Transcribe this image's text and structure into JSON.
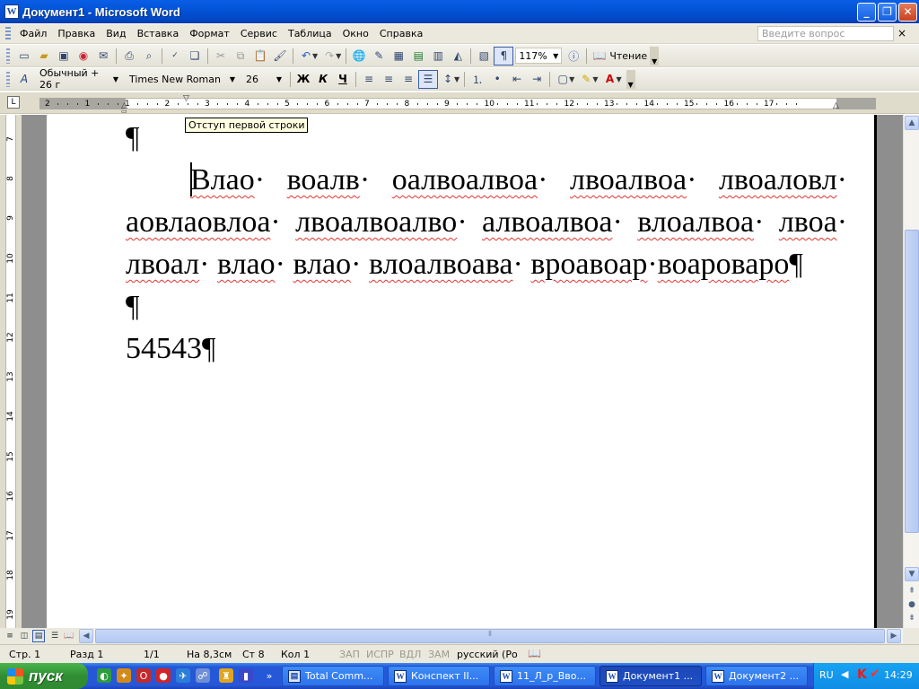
{
  "window": {
    "title": "Документ1 - Microsoft Word",
    "app_icon_letter": "W",
    "minimize": "_",
    "maximize": "❐",
    "close": "✕"
  },
  "menu": {
    "items": [
      "Файл",
      "Правка",
      "Вид",
      "Вставка",
      "Формат",
      "Сервис",
      "Таблица",
      "Окно",
      "Справка"
    ],
    "ask_placeholder": "Введите вопрос",
    "close_label": "×"
  },
  "toolbar_standard": {
    "zoom": "117%",
    "reading_label": "Чтение",
    "pilcrow": "¶"
  },
  "toolbar_formatting": {
    "style_value": "Обычный + 26 г",
    "font_value": "Times New Roman",
    "size_value": "26",
    "bold": "Ж",
    "italic": "К",
    "underline": "Ч"
  },
  "ruler": {
    "numbers": [
      "2",
      "1",
      "1",
      "2",
      "3",
      "4",
      "5",
      "6",
      "7",
      "8",
      "9",
      "10",
      "11",
      "12",
      "13",
      "14",
      "15",
      "16",
      "17"
    ],
    "tab_stop": "L",
    "tooltip": "Отступ первой строки"
  },
  "vertical_ruler": {
    "numbers": [
      "7",
      "8",
      "9",
      "10",
      "11",
      "12",
      "13",
      "14",
      "15",
      "16",
      "17",
      "18",
      "19"
    ]
  },
  "document": {
    "pilcrow": "¶",
    "main_words": [
      "Влао",
      "воалв",
      "оалвоалвоа",
      "лвоалвоа",
      "лвоаловл",
      "аовлаовлоа",
      "лвоалвоалво",
      "алвоалвоа",
      "влоалвоа",
      "лвоа",
      "лвоал",
      "влао",
      "влао",
      "влоалвоава",
      "вроавоар",
      "воароваро"
    ],
    "number_line": "54543"
  },
  "statusbar": {
    "page": "Стр. 1",
    "section": "Разд 1",
    "pages": "1/1",
    "at": "На 8,3см",
    "line": "Ст 8",
    "column": "Кол 1",
    "rec": "ЗАП",
    "trk": "ИСПР",
    "ext": "ВДЛ",
    "ovr": "ЗАМ",
    "language": "русский (Ро"
  },
  "taskbar": {
    "start_label": "пуск",
    "tasks": [
      "Total Comm...",
      "Конспект II...",
      "11_Л_р_Вво...",
      "Документ1 ...",
      "Документ2 ..."
    ],
    "active_task_index": 3,
    "language": "RU",
    "clock": "14:29"
  },
  "colors": {
    "titlebar": "#0354d8",
    "spellcheck": "#e23232",
    "taskbar": "#2557d8",
    "start": "#308d33"
  }
}
